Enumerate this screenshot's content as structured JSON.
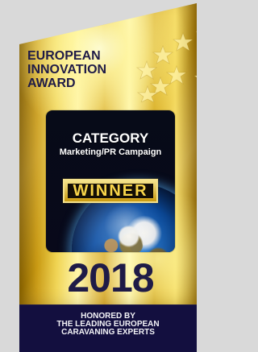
{
  "award": {
    "title": "EUROPEAN\nINNOVATION\nAWARD",
    "category_label": "CATEGORY",
    "category_value": "Marketing/PR Campaign",
    "winner_label": "WINNER",
    "year": "2018",
    "footer_lines": [
      "HONORED BY",
      "THE LEADING EUROPEAN",
      "CARAVANING EXPERTS"
    ]
  },
  "colors": {
    "gold": "#e0b529",
    "navy": "#1f1b47",
    "footer": "#130f3f",
    "winner_text": "#f8d54a",
    "background": "#d9d9d9"
  },
  "icons": {
    "stars": "star-icon",
    "globe": "earth-globe-icon"
  }
}
